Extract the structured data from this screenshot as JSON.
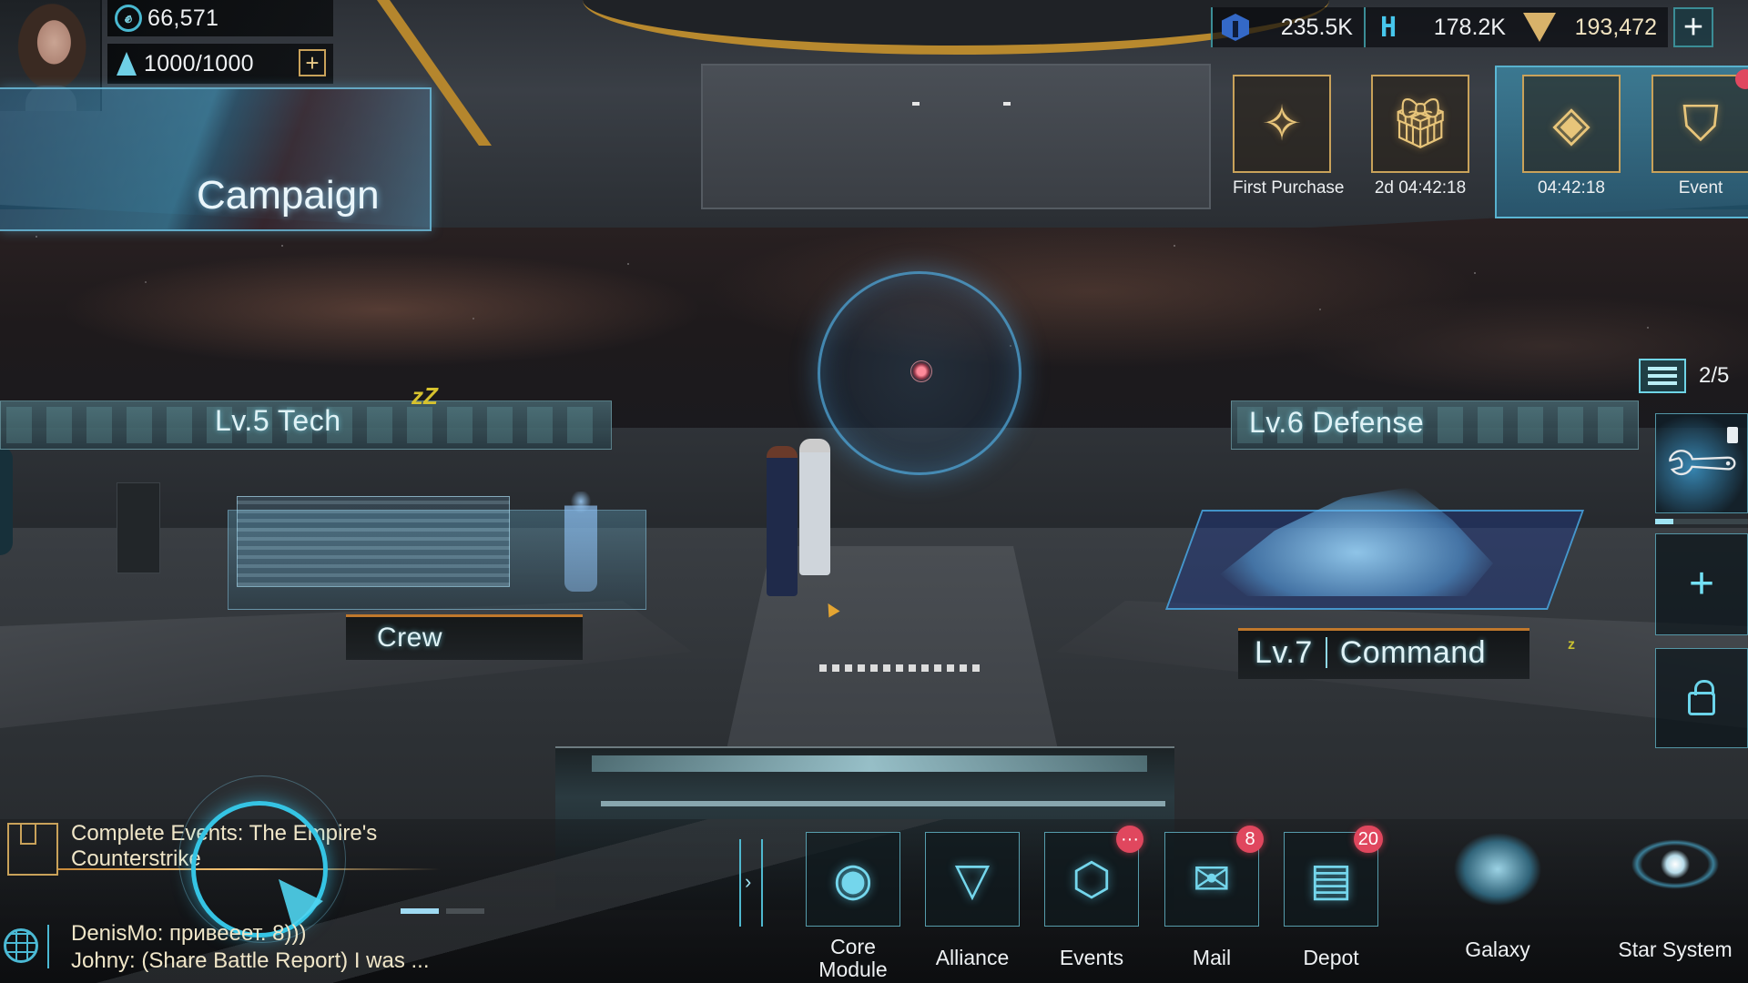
{
  "player": {
    "power": "66,571",
    "energy": "1000/1000",
    "add_energy_label": "+"
  },
  "currencies": [
    {
      "name": "alloy",
      "icon": "shield-icon",
      "value": "235.5K",
      "color": "#3469c7"
    },
    {
      "name": "crystal",
      "icon": "h-block-icon",
      "value": "178.2K",
      "color": "#47c7ec"
    },
    {
      "name": "gems",
      "icon": "gem-icon",
      "value": "193,472",
      "color": "#d8b26a"
    }
  ],
  "add_currency_label": "+",
  "campaign": {
    "label": "Campaign"
  },
  "events_bar": [
    {
      "label": "First Purchase",
      "icon": "star-gem-icon",
      "glyph": "✧"
    },
    {
      "label": "2d 04:42:18",
      "icon": "gift-icon",
      "glyph": "🎁︎"
    },
    {
      "label": "04:42:18",
      "icon": "chest-icon",
      "glyph": "◈"
    },
    {
      "label": "Event",
      "icon": "badge-star-icon",
      "glyph": "⛉",
      "notification": true
    }
  ],
  "stations": {
    "tech": {
      "label": "Lv.5  Tech",
      "idle_indicator": "zZ"
    },
    "defense": {
      "label": "Lv.6  Defense"
    },
    "crew": {
      "label": "Crew"
    },
    "command": {
      "level": "Lv.7",
      "label": "Command",
      "idle_indicator": "z"
    }
  },
  "queue": {
    "count": "2/5",
    "slots": [
      {
        "state": "active",
        "icon": "wrench-icon",
        "glyph": "🔧︎",
        "progress": 0.2
      },
      {
        "state": "empty",
        "icon": "plus-icon",
        "glyph": "+"
      },
      {
        "state": "locked",
        "icon": "lock-icon"
      }
    ]
  },
  "quest": {
    "text_line1": "Complete Events: The Empire's",
    "text_line2": "Counterstrike"
  },
  "chat": {
    "active_tab": 0,
    "tabs": 2,
    "messages": [
      {
        "text": "DenisMo: привееет. 8)))"
      },
      {
        "text": "Johny:  (Share Battle Report) I was ..."
      }
    ]
  },
  "nav": {
    "expand_glyph": "›",
    "items": [
      {
        "label": "Core Module",
        "icon": "core-module-icon",
        "glyph": "◉",
        "badge": null
      },
      {
        "label": "Alliance",
        "icon": "alliance-icon",
        "glyph": "▽",
        "badge": null
      },
      {
        "label": "Events",
        "icon": "icosahedron-icon",
        "glyph": "⬡",
        "badge": "···"
      },
      {
        "label": "Mail",
        "icon": "mail-icon",
        "glyph": "✉",
        "badge": "8"
      },
      {
        "label": "Depot",
        "icon": "depot-icon",
        "glyph": "▤",
        "badge": "20"
      }
    ]
  },
  "map_buttons": [
    {
      "label": "Galaxy",
      "icon": "galaxy-icon"
    },
    {
      "label": "Star System",
      "icon": "star-system-icon"
    }
  ],
  "colors": {
    "accent_cyan": "#6fd4e6",
    "accent_gold": "#c9a25a",
    "badge_red": "#e0475e"
  }
}
